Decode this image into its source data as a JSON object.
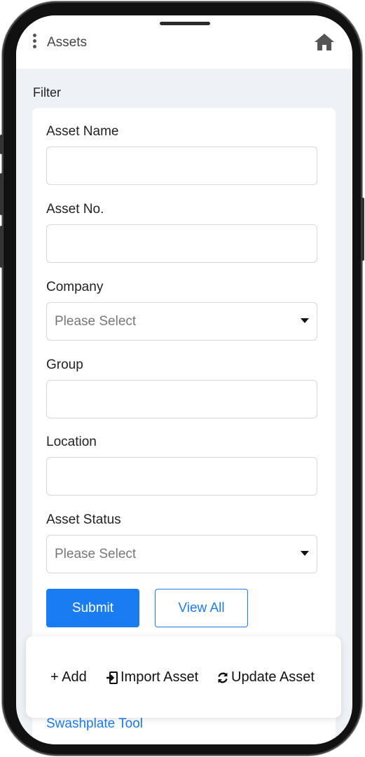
{
  "header": {
    "title": "Assets"
  },
  "filter": {
    "title": "Filter",
    "fields": [
      {
        "label": "Asset Name",
        "value": ""
      },
      {
        "label": "Asset No.",
        "value": ""
      },
      {
        "label": "Company",
        "placeholder": "Please Select"
      },
      {
        "label": "Group",
        "value": ""
      },
      {
        "label": "Location",
        "value": ""
      },
      {
        "label": "Asset Status",
        "placeholder": "Please Select"
      }
    ],
    "submit_label": "Submit",
    "view_all_label": "View All"
  },
  "actions": {
    "add_label": "+ Add",
    "import_label": "Import Asset",
    "update_label": "Update Asset"
  },
  "links": {
    "swashplate_label": "Swashplate Tool"
  },
  "colors": {
    "accent": "#1a7cf2",
    "background": "#eef2f6"
  },
  "icons": {
    "menu": "kebab-menu-icon",
    "home": "home-icon",
    "import": "import-icon",
    "update": "refresh-icon"
  }
}
